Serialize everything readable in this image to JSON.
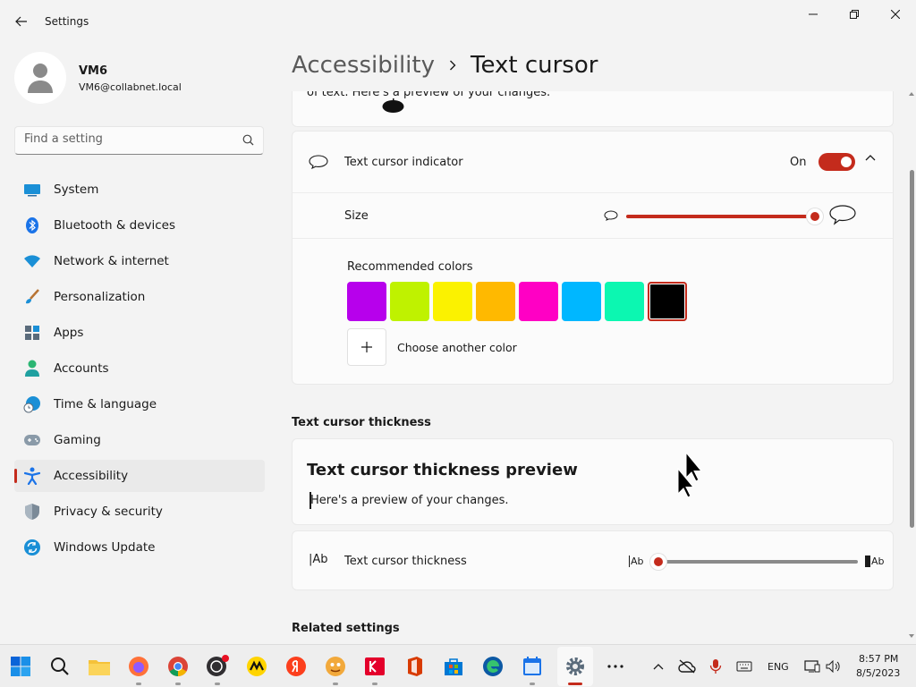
{
  "window": {
    "title": "Settings"
  },
  "user": {
    "name": "VM6",
    "email": "VM6@collabnet.local"
  },
  "search": {
    "placeholder": "Find a setting"
  },
  "sidebar": {
    "items": [
      {
        "label": "System"
      },
      {
        "label": "Bluetooth & devices"
      },
      {
        "label": "Network & internet"
      },
      {
        "label": "Personalization"
      },
      {
        "label": "Apps"
      },
      {
        "label": "Accounts"
      },
      {
        "label": "Time & language"
      },
      {
        "label": "Gaming"
      },
      {
        "label": "Accessibility"
      },
      {
        "label": "Privacy & security"
      },
      {
        "label": "Windows Update"
      }
    ],
    "active": "Accessibility"
  },
  "breadcrumb": {
    "parent": "Accessibility",
    "current": "Text cursor"
  },
  "partial_card": {
    "text": "of text. Here's a preview of your changes."
  },
  "indicator": {
    "label": "Text cursor indicator",
    "state": "On",
    "size_label": "Size",
    "size_value_fraction": 1.0,
    "recommended_label": "Recommended colors",
    "colors": [
      "#b700ec",
      "#bff200",
      "#fbf200",
      "#ffb900",
      "#ff00c4",
      "#00b7ff",
      "#0cf7b1",
      "#000000"
    ],
    "selected_color": "#000000",
    "choose_label": "Choose another color"
  },
  "thickness": {
    "section_title": "Text cursor thickness",
    "preview_title": "Text cursor thickness preview",
    "preview_text": "Here's a preview of your changes.",
    "label": "Text cursor thickness",
    "icon_text": "Ab",
    "small_text": "Ab",
    "large_text": "Ab",
    "value_fraction": 0.0
  },
  "related": {
    "title": "Related settings"
  },
  "taskbar": {
    "tray_lang": "ENG",
    "time": "8:57 PM",
    "date": "8/5/2023"
  },
  "colors": {
    "accent": "#c42b1c",
    "background": "#f3f3f3",
    "card": "#fbfbfb"
  }
}
